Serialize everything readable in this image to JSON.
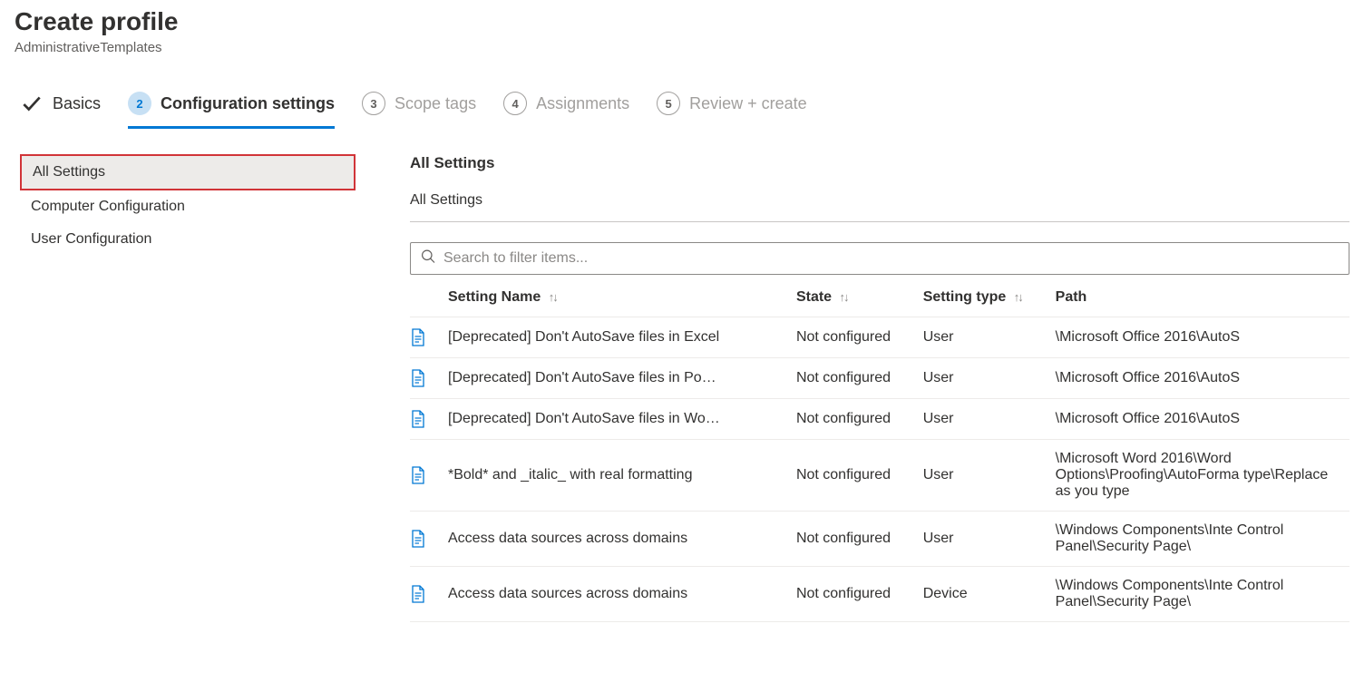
{
  "header": {
    "title": "Create profile",
    "subtitle": "AdministrativeTemplates"
  },
  "wizard": {
    "steps": [
      {
        "label": "Basics",
        "state": "done"
      },
      {
        "num": "2",
        "label": "Configuration settings",
        "state": "active"
      },
      {
        "num": "3",
        "label": "Scope tags",
        "state": "future"
      },
      {
        "num": "4",
        "label": "Assignments",
        "state": "future"
      },
      {
        "num": "5",
        "label": "Review + create",
        "state": "future"
      }
    ]
  },
  "tree": {
    "items": [
      {
        "label": "All Settings",
        "selected": true
      },
      {
        "label": "Computer Configuration",
        "selected": false
      },
      {
        "label": "User Configuration",
        "selected": false
      }
    ]
  },
  "content": {
    "section_title": "All Settings",
    "breadcrumb": "All Settings",
    "search": {
      "placeholder": "Search to filter items..."
    },
    "columns": {
      "name": "Setting Name",
      "state": "State",
      "type": "Setting type",
      "path": "Path"
    },
    "rows": [
      {
        "name": "[Deprecated] Don't AutoSave files in Excel",
        "state": "Not configured",
        "type": "User",
        "path": "\\Microsoft Office 2016\\AutoS"
      },
      {
        "name": "[Deprecated] Don't AutoSave files in Po…",
        "state": "Not configured",
        "type": "User",
        "path": "\\Microsoft Office 2016\\AutoS"
      },
      {
        "name": "[Deprecated] Don't AutoSave files in Wo…",
        "state": "Not configured",
        "type": "User",
        "path": "\\Microsoft Office 2016\\AutoS"
      },
      {
        "name": "*Bold* and _italic_ with real formatting",
        "state": "Not configured",
        "type": "User",
        "path": "\\Microsoft Word 2016\\Word Options\\Proofing\\AutoForma type\\Replace as you type"
      },
      {
        "name": "Access data sources across domains",
        "state": "Not configured",
        "type": "User",
        "path": "\\Windows Components\\Inte Control Panel\\Security Page\\"
      },
      {
        "name": "Access data sources across domains",
        "state": "Not configured",
        "type": "Device",
        "path": "\\Windows Components\\Inte Control Panel\\Security Page\\"
      }
    ]
  }
}
